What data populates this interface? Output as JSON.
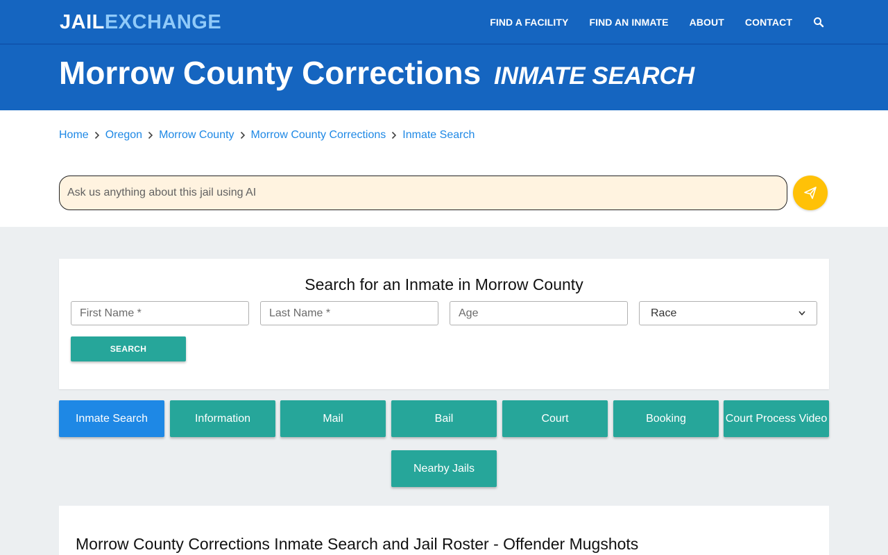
{
  "header": {
    "logo_part1": "JAIL",
    "logo_part2": "EXCHANGE",
    "nav": [
      "FIND A FACILITY",
      "FIND AN INMATE",
      "ABOUT",
      "CONTACT"
    ],
    "search_icon": "search-icon"
  },
  "hero": {
    "title": "Morrow County Corrections",
    "subtitle": "INMATE SEARCH"
  },
  "breadcrumb": [
    "Home",
    "Oregon",
    "Morrow County",
    "Morrow County Corrections",
    "Inmate Search"
  ],
  "ai": {
    "placeholder": "Ask us anything about this jail using AI",
    "send_icon": "paper-plane-icon"
  },
  "search_form": {
    "title": "Search for an Inmate in Morrow County",
    "first_name_placeholder": "First Name *",
    "last_name_placeholder": "Last Name *",
    "age_placeholder": "Age",
    "race_selected": "Race",
    "submit_label": "SEARCH"
  },
  "tabs": [
    "Inmate Search",
    "Information",
    "Mail",
    "Bail",
    "Court",
    "Booking",
    "Court Process Video",
    "Nearby Jails"
  ],
  "content": {
    "heading": "Morrow County Corrections Inmate Search and Jail Roster - Offender Mugshots"
  },
  "colors": {
    "header_bg": "#1565c0",
    "teal": "#26a69a",
    "active_tab": "#1e88e5",
    "send_button": "#ffc107",
    "ai_input_bg": "#fff3e0"
  }
}
